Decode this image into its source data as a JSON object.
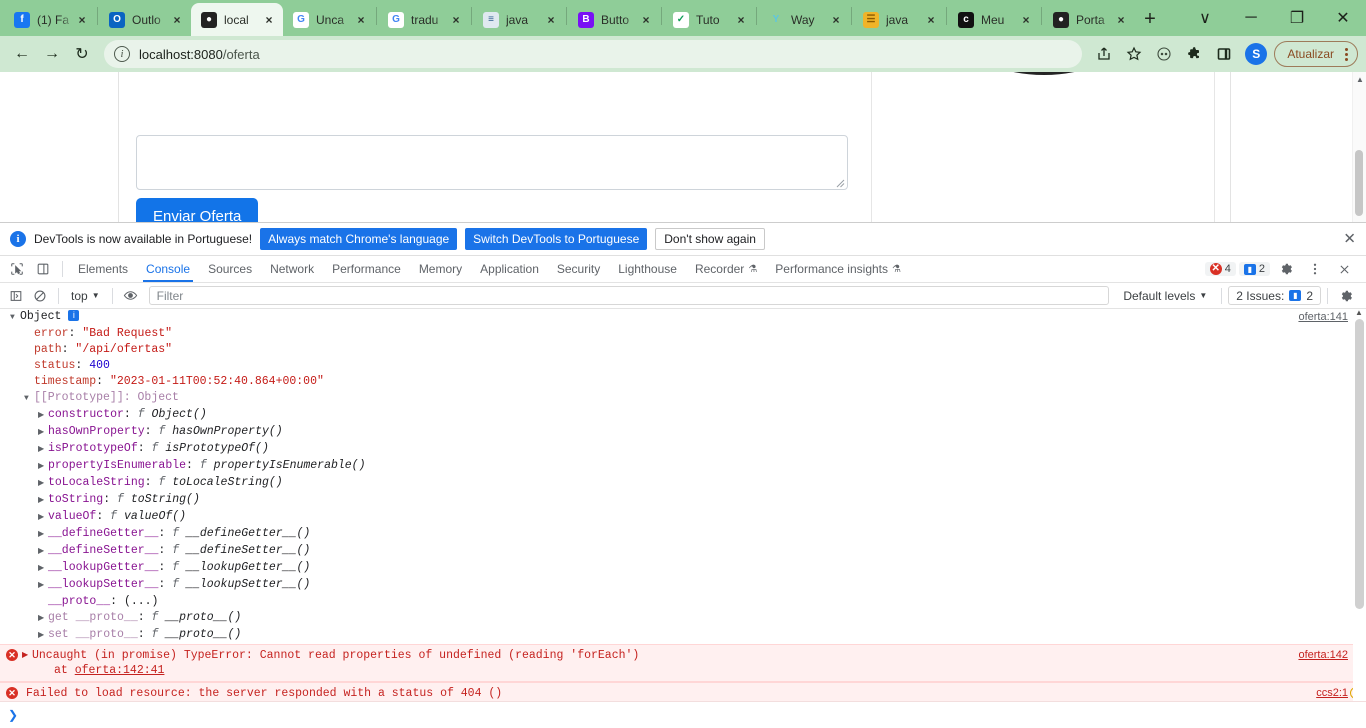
{
  "browser": {
    "tabs": [
      {
        "title": "(1) Fa",
        "favicon": "facebook-icon",
        "color": "#1877f2",
        "glyph": "f",
        "active": false
      },
      {
        "title": "Outlo",
        "favicon": "outlook-icon",
        "color": "#0a64c2",
        "glyph": "O",
        "active": false
      },
      {
        "title": "local",
        "favicon": "globe-icon",
        "color": "#222222",
        "glyph": "●",
        "active": true
      },
      {
        "title": "Unca",
        "favicon": "google-icon",
        "color": "#ffffff",
        "glyph": "G",
        "active": false
      },
      {
        "title": "tradu",
        "favicon": "google-icon",
        "color": "#ffffff",
        "glyph": "G",
        "active": false
      },
      {
        "title": "java",
        "favicon": "stack-icon",
        "color": "#dfe9f0",
        "glyph": "≡",
        "active": false
      },
      {
        "title": "Butto",
        "favicon": "bootstrap-icon",
        "color": "#7911f5",
        "glyph": "B",
        "active": false
      },
      {
        "title": "Tuto",
        "favicon": "note-icon",
        "color": "#0f9d58",
        "glyph": "✓",
        "active": false
      },
      {
        "title": "Way",
        "favicon": "yahoo-icon",
        "color": "#5ec6e0",
        "glyph": "Y",
        "active": false
      },
      {
        "title": "java",
        "favicon": "book-icon",
        "color": "#f0b429",
        "glyph": "☰",
        "active": false
      },
      {
        "title": "Meu",
        "favicon": "console-icon",
        "color": "#111111",
        "glyph": "c",
        "active": false
      },
      {
        "title": "Porta",
        "favicon": "globe-icon",
        "color": "#222222",
        "glyph": "●",
        "active": false
      }
    ],
    "tab_close_label": "×",
    "new_tab_label": "+",
    "window_controls": {
      "tab_search": "∨",
      "minimize": "─",
      "maximize": "❐",
      "close": "✕"
    },
    "nav": {
      "back": "←",
      "forward": "→",
      "reload": "↻"
    },
    "omnibox": {
      "site_info_icon": "info-icon",
      "site_info_glyph": "i",
      "host": "localhost:8080",
      "path": "/oferta",
      "full_url": "localhost:8080/oferta"
    },
    "toolbar_icons": {
      "share": "⤴",
      "bookmark": "☆",
      "profile_sync": "◎",
      "extensions": "🧩",
      "sidepanel": "⬜"
    },
    "avatar_initial": "S",
    "update_button": "Atualizar",
    "menu_icon": "kebab-menu-icon"
  },
  "page": {
    "submit_button": "Enviar Oferta",
    "textarea_value": "",
    "product_image_alt": "black-smartwatch-strap"
  },
  "devtools": {
    "notice": {
      "icon": "info-icon",
      "text": "DevTools is now available in Portuguese!",
      "primary_button": "Always match Chrome's language",
      "secondary_button": "Switch DevTools to Portuguese",
      "tertiary_button": "Don't show again",
      "close": "✕"
    },
    "panel_tabs": [
      {
        "label": "Elements",
        "active": false,
        "beaker": false
      },
      {
        "label": "Console",
        "active": true,
        "beaker": false
      },
      {
        "label": "Sources",
        "active": false,
        "beaker": false
      },
      {
        "label": "Network",
        "active": false,
        "beaker": false
      },
      {
        "label": "Performance",
        "active": false,
        "beaker": false
      },
      {
        "label": "Memory",
        "active": false,
        "beaker": false
      },
      {
        "label": "Application",
        "active": false,
        "beaker": false
      },
      {
        "label": "Security",
        "active": false,
        "beaker": false
      },
      {
        "label": "Lighthouse",
        "active": false,
        "beaker": false
      },
      {
        "label": "Recorder",
        "active": false,
        "beaker": true
      },
      {
        "label": "Performance insights",
        "active": false,
        "beaker": true
      }
    ],
    "status_counts": {
      "errors": "4",
      "messages": "2"
    },
    "settings_icon": "gear-icon",
    "more_icon": "kebab-menu-icon",
    "close_icon": "close-icon",
    "console_toolbar": {
      "sidebar_icon": "console-sidebar-icon",
      "clear_icon": "clear-console-icon",
      "context": "top",
      "context_caret": "▼",
      "eye_icon": "live-expression-icon",
      "filter_placeholder": "Filter",
      "filter_value": "",
      "levels": "Default levels",
      "levels_caret": "▼",
      "issues_label": "2 Issues:",
      "issues_count": "2",
      "settings_icon": "gear-icon"
    },
    "console": {
      "object_log": {
        "source": "oferta:141",
        "header": "Object",
        "badge": "i",
        "props": [
          {
            "key": "error",
            "value": "\"Bad Request\"",
            "type": "string"
          },
          {
            "key": "path",
            "value": "\"/api/ofertas\"",
            "type": "string"
          },
          {
            "key": "status",
            "value": "400",
            "type": "number"
          },
          {
            "key": "timestamp",
            "value": "\"2023-01-11T00:52:40.864+00:00\"",
            "type": "string"
          }
        ],
        "prototype_header": "[[Prototype]]: Object",
        "prototype_props": [
          {
            "key": "constructor",
            "fn": "Object()"
          },
          {
            "key": "hasOwnProperty",
            "fn": "hasOwnProperty()"
          },
          {
            "key": "isPrototypeOf",
            "fn": "isPrototypeOf()"
          },
          {
            "key": "propertyIsEnumerable",
            "fn": "propertyIsEnumerable()"
          },
          {
            "key": "toLocaleString",
            "fn": "toLocaleString()"
          },
          {
            "key": "toString",
            "fn": "toString()"
          },
          {
            "key": "valueOf",
            "fn": "valueOf()"
          },
          {
            "key": "__defineGetter__",
            "fn": "__defineGetter__()"
          },
          {
            "key": "__defineSetter__",
            "fn": "__defineSetter__()"
          },
          {
            "key": "__lookupGetter__",
            "fn": "__lookupGetter__()"
          },
          {
            "key": "__lookupSetter__",
            "fn": "__lookupSetter__()"
          }
        ],
        "proto_line_key": "__proto__",
        "proto_line_value": "(...)",
        "accessors": [
          {
            "prefix": "get",
            "key": "__proto__",
            "fn": "__proto__()"
          },
          {
            "prefix": "set",
            "key": "__proto__",
            "fn": "__proto__()"
          }
        ]
      },
      "errors": [
        {
          "text": "Uncaught (in promise) TypeError: Cannot read properties of undefined (reading 'forEach')",
          "stack_prefix": "at ",
          "stack_link": "oferta:142:41",
          "source": "oferta:142",
          "has_warning_icon": false,
          "expandable": true
        },
        {
          "text": "Failed to load resource: the server responded with a status of 404 ()",
          "stack_prefix": "",
          "stack_link": "",
          "source": "ccs2:1",
          "has_warning_icon": true,
          "expandable": false
        }
      ],
      "prompt_chevron": "❯"
    }
  },
  "colors": {
    "chrome_tabstrip": "#8fcd98",
    "chrome_toolbar": "#cfe8d2",
    "accent_blue": "#1a73e8",
    "error_red": "#d93025",
    "error_bg": "#fff0f0",
    "button_blue": "#1274e8"
  }
}
